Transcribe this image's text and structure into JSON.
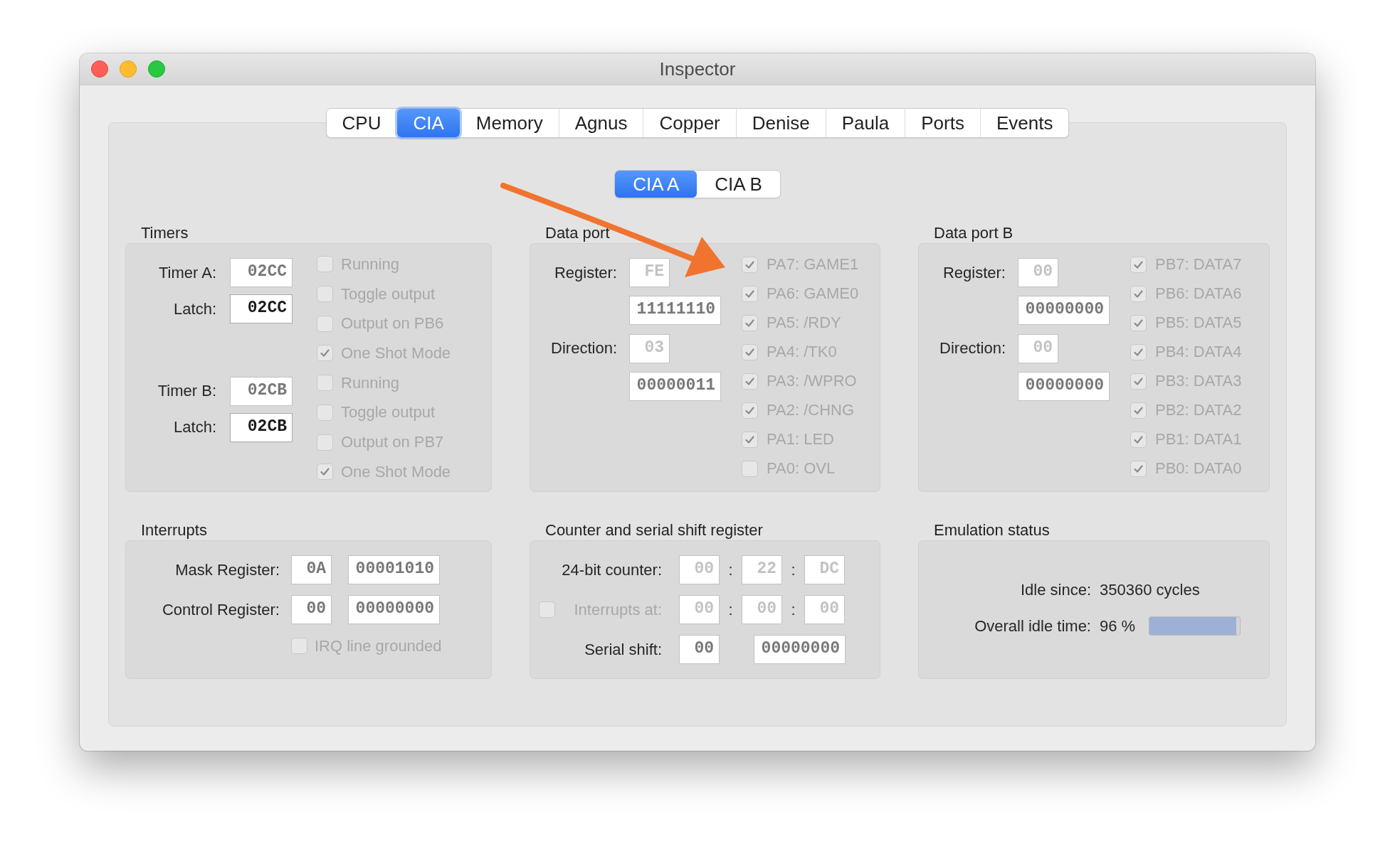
{
  "window": {
    "title": "Inspector"
  },
  "tabs": [
    {
      "label": "CPU",
      "selected": false
    },
    {
      "label": "CIA",
      "selected": true
    },
    {
      "label": "Memory",
      "selected": false
    },
    {
      "label": "Agnus",
      "selected": false
    },
    {
      "label": "Copper",
      "selected": false
    },
    {
      "label": "Denise",
      "selected": false
    },
    {
      "label": "Paula",
      "selected": false
    },
    {
      "label": "Ports",
      "selected": false
    },
    {
      "label": "Events",
      "selected": false
    }
  ],
  "cia_tabs": [
    {
      "label": "CIA A",
      "selected": true
    },
    {
      "label": "CIA B",
      "selected": false
    }
  ],
  "timers": {
    "title": "Timers",
    "items": [
      {
        "label": "Timer A:",
        "counter": {
          "value": "02CC",
          "disabled": false,
          "editable": false
        },
        "latch_label": "Latch:",
        "latch": {
          "value": "02CC",
          "disabled": false,
          "editable": true
        },
        "options": [
          {
            "label": "Running",
            "checked": false,
            "disabled": true
          },
          {
            "label": "Toggle output",
            "checked": false,
            "disabled": true
          },
          {
            "label": "Output on PB6",
            "checked": false,
            "disabled": true
          },
          {
            "label": "One Shot Mode",
            "checked": true,
            "disabled": true
          }
        ]
      },
      {
        "label": "Timer B:",
        "counter": {
          "value": "02CB",
          "disabled": false,
          "editable": false
        },
        "latch_label": "Latch:",
        "latch": {
          "value": "02CB",
          "disabled": false,
          "editable": true
        },
        "options": [
          {
            "label": "Running",
            "checked": false,
            "disabled": true
          },
          {
            "label": "Toggle output",
            "checked": false,
            "disabled": true
          },
          {
            "label": "Output on PB7",
            "checked": false,
            "disabled": true
          },
          {
            "label": "One Shot Mode",
            "checked": true,
            "disabled": true
          }
        ]
      }
    ]
  },
  "ports": [
    {
      "title": "Data port",
      "registers": [
        {
          "label": "Register:",
          "hex": {
            "value": "FE",
            "disabled": true,
            "editable": false
          },
          "bits": {
            "value": "11111110",
            "disabled": false,
            "editable": false
          }
        },
        {
          "label": "Direction:",
          "hex": {
            "value": "03",
            "disabled": true,
            "editable": false
          },
          "bits": {
            "value": "00000011",
            "disabled": false,
            "editable": false
          }
        }
      ],
      "pins": [
        {
          "label": "PA7: GAME1",
          "checked": true,
          "disabled": true
        },
        {
          "label": "PA6: GAME0",
          "checked": true,
          "disabled": true
        },
        {
          "label": "PA5: /RDY",
          "checked": true,
          "disabled": true
        },
        {
          "label": "PA4: /TK0",
          "checked": true,
          "disabled": true
        },
        {
          "label": "PA3: /WPRO",
          "checked": true,
          "disabled": true
        },
        {
          "label": "PA2: /CHNG",
          "checked": true,
          "disabled": true
        },
        {
          "label": "PA1: LED",
          "checked": true,
          "disabled": true
        },
        {
          "label": "PA0: OVL",
          "checked": false,
          "disabled": true
        }
      ]
    },
    {
      "title": "Data port B",
      "registers": [
        {
          "label": "Register:",
          "hex": {
            "value": "00",
            "disabled": true,
            "editable": false
          },
          "bits": {
            "value": "00000000",
            "disabled": false,
            "editable": false
          }
        },
        {
          "label": "Direction:",
          "hex": {
            "value": "00",
            "disabled": true,
            "editable": false
          },
          "bits": {
            "value": "00000000",
            "disabled": false,
            "editable": false
          }
        }
      ],
      "pins": [
        {
          "label": "PB7: DATA7",
          "checked": true,
          "disabled": true
        },
        {
          "label": "PB6: DATA6",
          "checked": true,
          "disabled": true
        },
        {
          "label": "PB5: DATA5",
          "checked": true,
          "disabled": true
        },
        {
          "label": "PB4: DATA4",
          "checked": true,
          "disabled": true
        },
        {
          "label": "PB3: DATA3",
          "checked": true,
          "disabled": true
        },
        {
          "label": "PB2: DATA2",
          "checked": true,
          "disabled": true
        },
        {
          "label": "PB1: DATA1",
          "checked": true,
          "disabled": true
        },
        {
          "label": "PB0: DATA0",
          "checked": true,
          "disabled": true
        }
      ]
    }
  ],
  "interrupts": {
    "title": "Interrupts",
    "registers": [
      {
        "label": "Mask Register:",
        "hex": {
          "value": "0A",
          "disabled": false,
          "editable": false
        },
        "bits": {
          "value": "00001010",
          "disabled": false,
          "editable": false
        }
      },
      {
        "label": "Control Register:",
        "hex": {
          "value": "00",
          "disabled": false,
          "editable": false
        },
        "bits": {
          "value": "00000000",
          "disabled": false,
          "editable": false
        }
      }
    ],
    "irq_grounded": {
      "label": "IRQ line grounded",
      "checked": false,
      "disabled": true
    }
  },
  "counter": {
    "title": "Counter and serial shift register",
    "rows": [
      {
        "kind": "counter",
        "label": "24-bit counter:",
        "fields": [
          {
            "value": "00",
            "disabled": true,
            "editable": false
          },
          {
            "value": "22",
            "disabled": true,
            "editable": false
          },
          {
            "value": "DC",
            "disabled": true,
            "editable": false
          }
        ],
        "separators": [
          ":",
          ":"
        ]
      },
      {
        "kind": "alarm",
        "checkbox": {
          "label": "Interrupts at:",
          "checked": false,
          "disabled": true
        },
        "fields": [
          {
            "value": "00",
            "disabled": true,
            "editable": false
          },
          {
            "value": "00",
            "disabled": true,
            "editable": false
          },
          {
            "value": "00",
            "disabled": true,
            "editable": false
          }
        ],
        "separators": [
          ":",
          ":"
        ]
      },
      {
        "kind": "shift",
        "label": "Serial shift:",
        "hex": {
          "value": "00",
          "disabled": false,
          "editable": false
        },
        "bits": {
          "value": "00000000",
          "disabled": false,
          "editable": false
        }
      }
    ]
  },
  "emulation": {
    "title": "Emulation status",
    "rows": [
      {
        "kind": "text",
        "label": "Idle since:",
        "value": "350360 cycles"
      },
      {
        "kind": "meter",
        "label": "Overall idle time:",
        "value": "96 %",
        "level": 0.96
      }
    ]
  }
}
